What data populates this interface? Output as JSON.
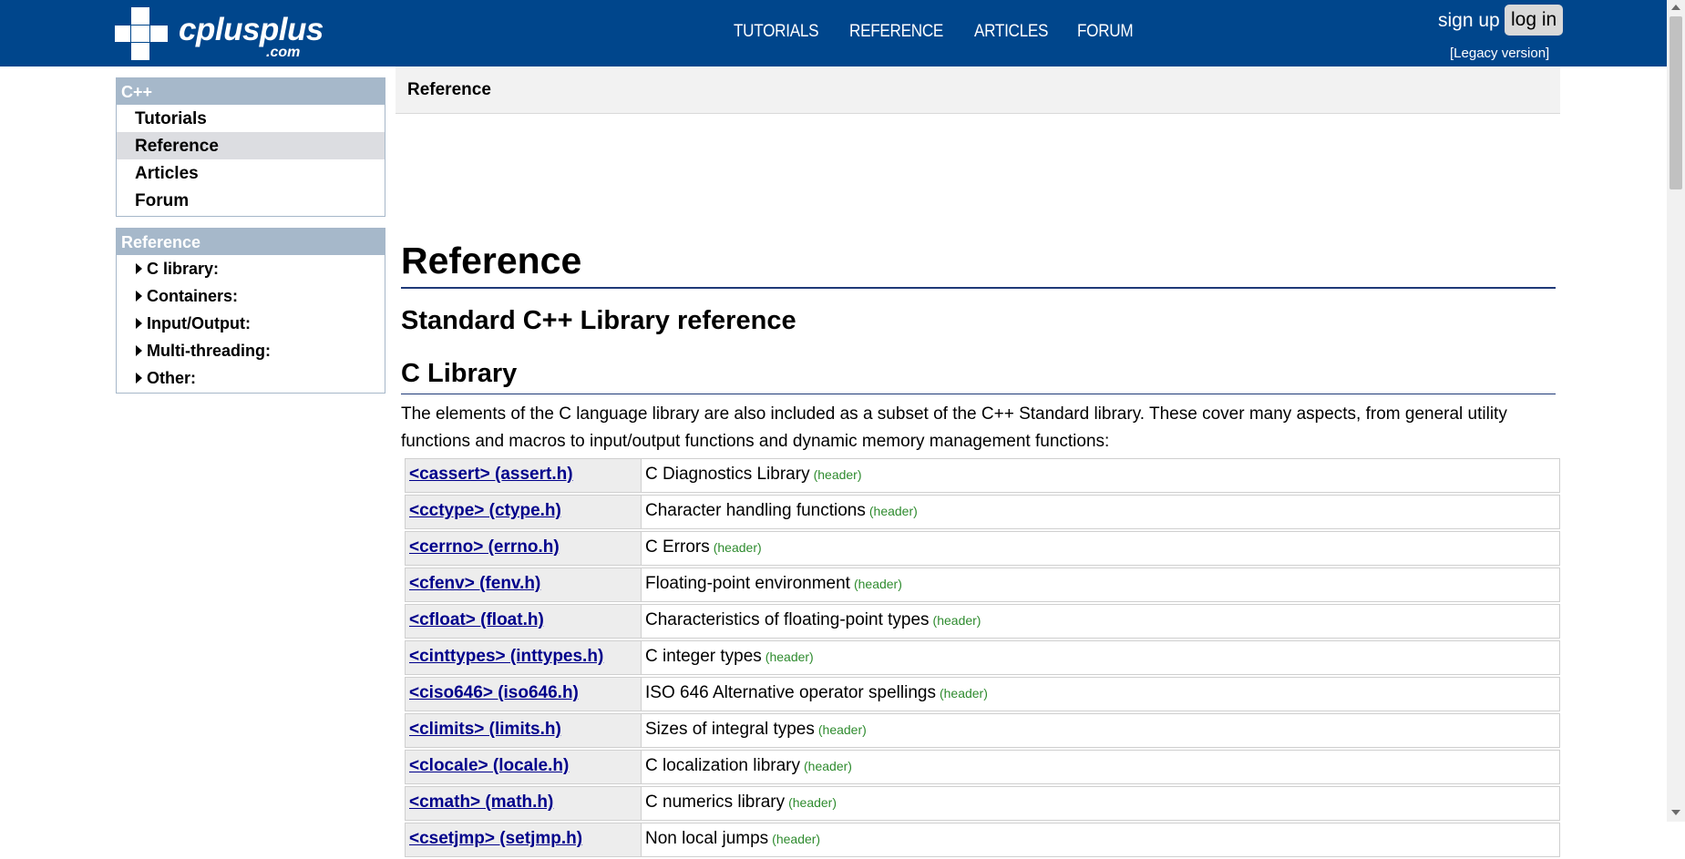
{
  "header": {
    "logo_text": "cplusplus",
    "logo_sub": ".com",
    "nav": [
      "TUTORIALS",
      "REFERENCE",
      "ARTICLES",
      "FORUM"
    ],
    "sign_up": "sign up",
    "log_in": "log in",
    "legacy": "[Legacy version]"
  },
  "sidebar": {
    "cpp_title": "C++",
    "cpp_items": [
      "Tutorials",
      "Reference",
      "Articles",
      "Forum"
    ],
    "active_item": "Reference",
    "ref_title": "Reference",
    "ref_items": [
      "C library:",
      "Containers:",
      "Input/Output:",
      "Multi-threading:",
      "Other:"
    ]
  },
  "main": {
    "breadcrumb": "Reference",
    "title": "Reference",
    "subtitle": "Standard C++ Library reference",
    "section": "C Library",
    "intro": "The elements of the C language library are also included as a subset of the C++ Standard library. These cover many aspects, from general utility functions and macros to input/output functions and dynamic memory management functions:",
    "libraries": [
      {
        "name": "<cassert> (assert.h)",
        "desc": "C Diagnostics Library",
        "tag": "(header)"
      },
      {
        "name": "<cctype> (ctype.h)",
        "desc": "Character handling functions",
        "tag": "(header)"
      },
      {
        "name": "<cerrno> (errno.h)",
        "desc": "C Errors",
        "tag": "(header)"
      },
      {
        "name": "<cfenv> (fenv.h)",
        "desc": "Floating-point environment",
        "tag": "(header)"
      },
      {
        "name": "<cfloat> (float.h)",
        "desc": "Characteristics of floating-point types",
        "tag": "(header)"
      },
      {
        "name": "<cinttypes> (inttypes.h)",
        "desc": "C integer types",
        "tag": "(header)"
      },
      {
        "name": "<ciso646> (iso646.h)",
        "desc": "ISO 646 Alternative operator spellings",
        "tag": "(header)"
      },
      {
        "name": "<climits> (limits.h)",
        "desc": "Sizes of integral types",
        "tag": "(header)"
      },
      {
        "name": "<clocale> (locale.h)",
        "desc": "C localization library",
        "tag": "(header)"
      },
      {
        "name": "<cmath> (math.h)",
        "desc": "C numerics library",
        "tag": "(header)"
      },
      {
        "name": "<csetjmp> (setjmp.h)",
        "desc": "Non local jumps",
        "tag": "(header)"
      }
    ]
  },
  "colors": {
    "header_bg": "#00468c",
    "sidebar_head": "#a6b8ca",
    "link": "#00008b",
    "header_tag": "#2e8b2e"
  }
}
